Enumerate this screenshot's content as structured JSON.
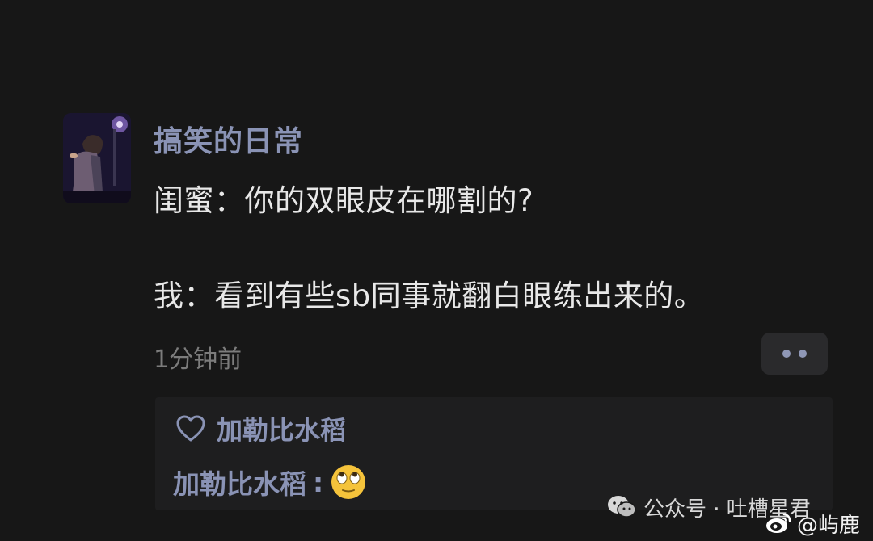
{
  "post": {
    "username": "搞笑的日常",
    "lines": [
      "闺蜜：你的双眼皮在哪割的?",
      "我：看到有些sb同事就翻白眼练出来的。"
    ],
    "time": "1分钟前",
    "more_icon": "more-dots-icon"
  },
  "interactions": {
    "like_icon": "heart-icon",
    "liked_by": "加勒比水稻",
    "reply": {
      "author": "加勒比水稻",
      "colon": ":",
      "emoji": "eye-roll-emoji"
    }
  },
  "watermarks": {
    "wechat": "公众号 · 吐槽星君",
    "weibo": "@屿鹿"
  },
  "colors": {
    "background": "#171717",
    "username": "#8a93b5",
    "body_text": "#e8e8e8",
    "time_text": "#7c7c7c"
  }
}
